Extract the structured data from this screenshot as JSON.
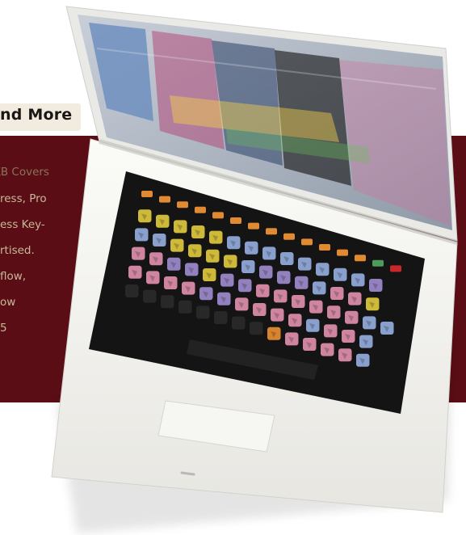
{
  "heading": "nd More",
  "text_lines": [
    "KB Covers",
    "ress, Pro",
    "ess Key-",
    "rtised.",
    "flow,",
    "ow",
    "5"
  ],
  "colors": {
    "panel": "#5a0d14",
    "title_bg": "#f1ecdf",
    "laptop_body": "#f2f2ee",
    "keyboard": "#141414",
    "key_yellow": "#d9c23a",
    "key_blue": "#8fa8d8",
    "key_purple": "#9a86c8",
    "key_pink": "#d98aa6",
    "key_orange": "#e28a32",
    "key_red": "#c8282a",
    "key_green": "#4f9a5a"
  }
}
